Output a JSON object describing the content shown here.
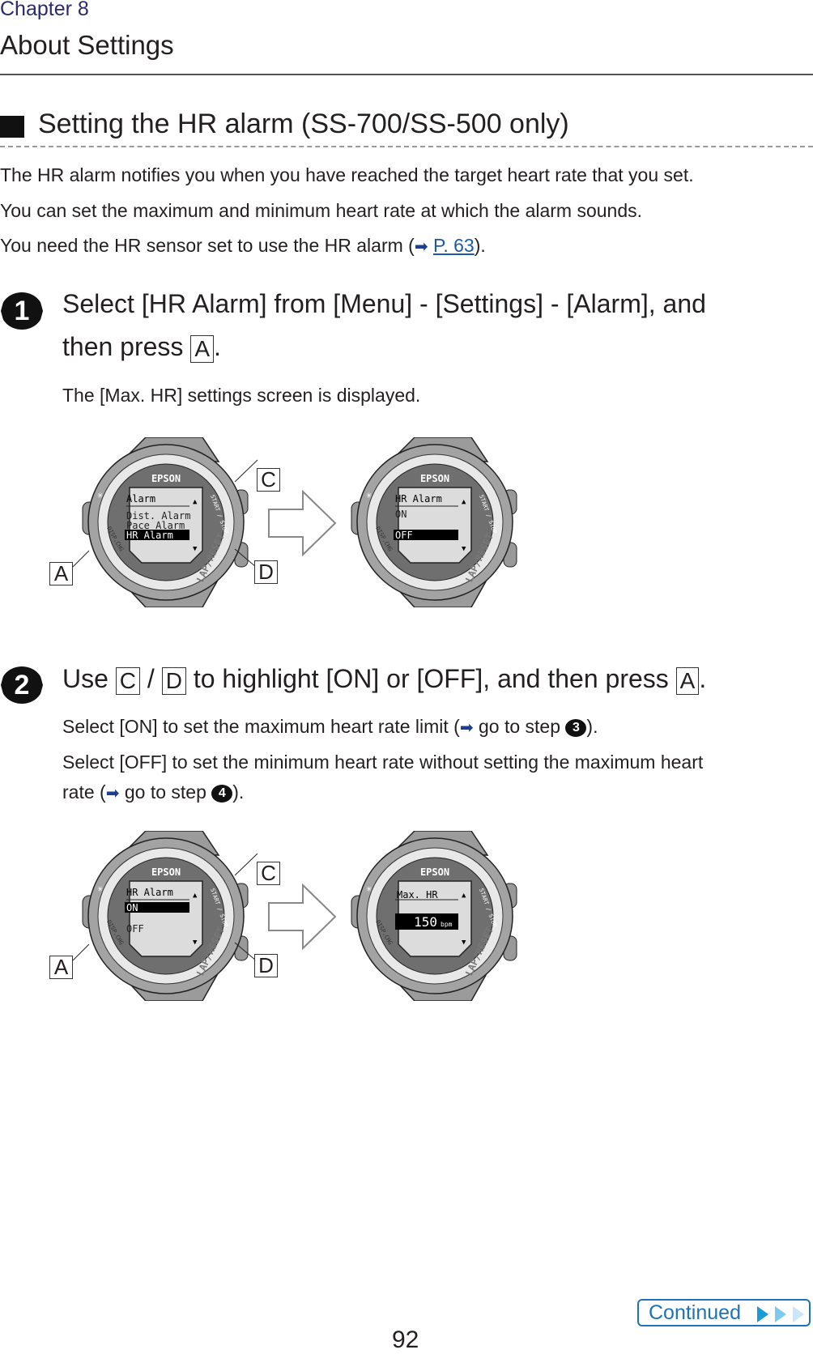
{
  "header": {
    "chapter": "Chapter 8",
    "title": "About Settings"
  },
  "section": {
    "title": "Setting the HR alarm (SS-700/SS-500 only)"
  },
  "intro": {
    "line1": "The HR alarm notifies you when you have reached the target heart rate that you set.",
    "line2": "You can set the maximum and minimum heart rate at which the alarm sounds.",
    "line3_pre": "You need the HR sensor set to use the HR alarm (",
    "line3_link": "P. 63",
    "line3_post": ")."
  },
  "step1": {
    "number": "1",
    "line1": "Select [HR Alarm] from [Menu] - [Settings] - [Alarm], and",
    "line2_pre": "then press ",
    "key": "A",
    "line2_post": ".",
    "body": "The [Max. HR] settings screen is displayed."
  },
  "step2": {
    "number": "2",
    "pre": "Use ",
    "key_c": "C",
    "sep": " / ",
    "key_d": "D",
    "mid": " to highlight [ON] or [OFF], and then press ",
    "key_a": "A",
    "post": ".",
    "body1_pre": "Select [ON] to set the maximum heart rate limit (",
    "body1_mid": " go to step ",
    "body1_step": "3",
    "body1_post": ").",
    "body2_line1": "Select [OFF] to set the minimum heart rate without setting the maximum heart",
    "body2_pre": "rate (",
    "body2_mid": " go to step ",
    "body2_step": "4",
    "body2_post": ")."
  },
  "watch": {
    "brand": "EPSON",
    "start_stop": "START / STOP",
    "lap_reset": "LAP/RESET",
    "disp_chg": "DISP.CHG"
  },
  "figure_labels": {
    "a": "A",
    "c": "C",
    "d": "D"
  },
  "screens": {
    "s1": {
      "title": "Alarm",
      "items": [
        "Dist. Alarm",
        "Pace Alarm",
        "HR Alarm"
      ],
      "selected": "HR Alarm"
    },
    "s2": {
      "title": "HR Alarm",
      "items": [
        "ON",
        "OFF"
      ],
      "selected": "OFF"
    },
    "s3": {
      "title": "HR Alarm",
      "items": [
        "ON",
        "OFF"
      ],
      "selected": "ON"
    },
    "s4": {
      "title": "Max. HR",
      "value": "150",
      "unit": "bpm"
    }
  },
  "footer": {
    "continued": "Continued",
    "page": "92"
  },
  "colors": {
    "chapter": "#2b2a6b",
    "link": "#1c5aa8",
    "continued": "#1e72b8"
  },
  "icons": {
    "ref_arrow": "right-arrow-icon",
    "next": "triple-chevron-icon"
  }
}
